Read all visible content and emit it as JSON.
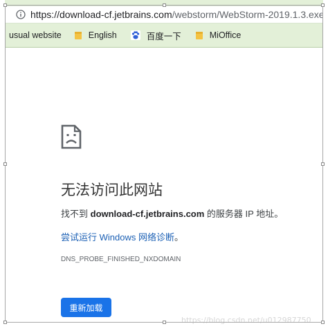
{
  "browser": {
    "url_host": "https://download-cf.jetbrains.com",
    "url_path": "/webstorm/WebStorm-2019.1.3.exe",
    "bookmarks": [
      {
        "label": "usual website",
        "icon": "none"
      },
      {
        "label": "English",
        "icon": "folder-icon"
      },
      {
        "label": "百度一下",
        "icon": "baidu-paw-icon"
      },
      {
        "label": "MiOffice",
        "icon": "folder-icon"
      }
    ],
    "accent_color": "#8dc63f"
  },
  "error": {
    "icon": "sad-page-icon",
    "title": "无法访问此网站",
    "desc_prefix": "找不到 ",
    "desc_host": "download-cf.jetbrains.com",
    "desc_suffix": " 的服务器 IP 地址。",
    "suggest_link": "尝试运行 Windows 网络诊断",
    "suggest_end": "。",
    "code": "DNS_PROBE_FINISHED_NXDOMAIN",
    "reload_label": "重新加载"
  },
  "watermark": "https://blog.csdn.net/u012987750"
}
